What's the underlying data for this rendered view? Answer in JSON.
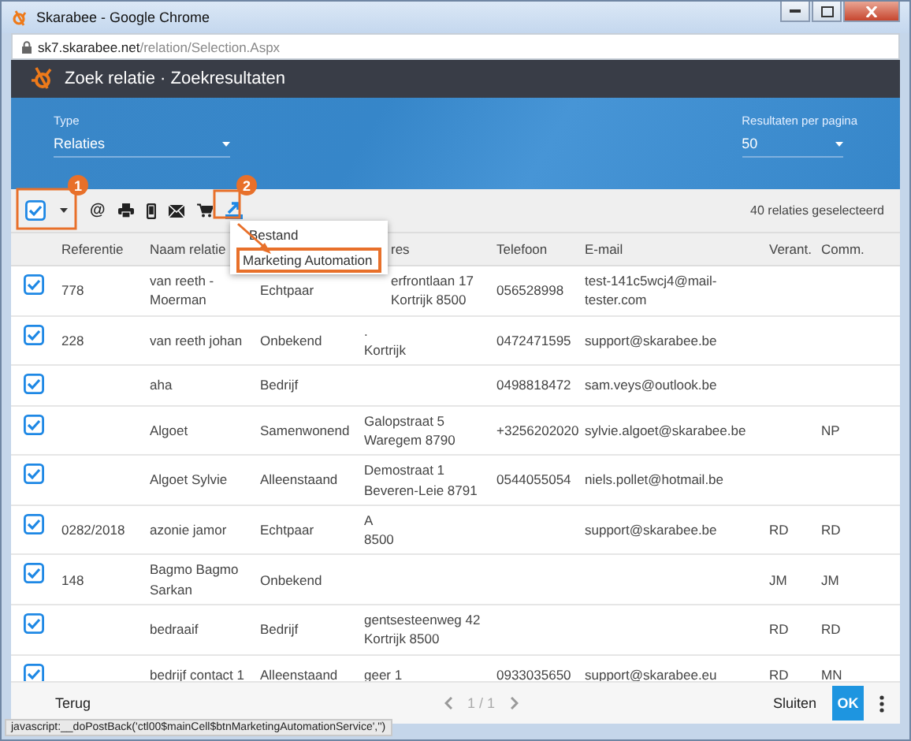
{
  "window": {
    "title": "Skarabee - Google Chrome",
    "url_host": "sk7.skarabee.net",
    "url_path": "/relation/Selection.Aspx"
  },
  "header": {
    "title": "Zoek relatie · Zoekresultaten"
  },
  "filters": [
    {
      "label": "Type",
      "value": "Relaties"
    },
    {
      "label": "Resultaten per pagina",
      "value": "50"
    }
  ],
  "toolbar": {
    "select_all": {
      "checked": true
    },
    "tools": [
      {
        "kind": "symbol",
        "symbol": "@"
      },
      {
        "kind": "printer"
      },
      {
        "kind": "phone"
      },
      {
        "kind": "envelope"
      },
      {
        "kind": "cart"
      },
      {
        "kind": "export"
      }
    ],
    "count": "40 relaties geselecteerd"
  },
  "export_menu": {
    "items": [
      {
        "label": "Bestand",
        "selected": false
      },
      {
        "label": "Marketing Automation",
        "selected": true
      }
    ]
  },
  "annotations": [
    {
      "label": "1"
    },
    {
      "label": "2"
    }
  ],
  "table": {
    "columns": [
      "Referentie",
      "Naam relatie",
      "res",
      "Telefoon",
      "E-mail",
      "Verant.",
      "Comm."
    ],
    "rows": [
      {
        "checked": true,
        "ref": "778",
        "name": "van reeth - Moerman",
        "type": "Echtpaar",
        "address": [
          "erfrontlaan 17",
          "Kortrijk 8500"
        ],
        "phone": "056528998",
        "email": "test-141c5wcj4@mail-tester.com"
      },
      {
        "checked": true,
        "ref": "228",
        "name": "van reeth johan",
        "type": "Onbekend",
        "address": [
          ".",
          "Kortrijk"
        ],
        "phone": "0472471595",
        "email": "support@skarabee.be"
      },
      {
        "checked": true,
        "name": "aha",
        "type": "Bedrijf",
        "phone": "0498818472",
        "email": "sam.veys@outlook.be"
      },
      {
        "checked": true,
        "name": "Algoet",
        "type": "Samenwonend",
        "address": [
          "Galopstraat 5",
          "Waregem 8790"
        ],
        "phone": "+3256202020",
        "email": "sylvie.algoet@skarabee.be",
        "comm": "NP"
      },
      {
        "checked": true,
        "name": "Algoet Sylvie",
        "type": "Alleenstaand",
        "address": [
          "Demostraat 1",
          "Beveren-Leie 8791"
        ],
        "phone": "0544055054",
        "email": "niels.pollet@hotmail.be"
      },
      {
        "checked": true,
        "ref": "0282/2018",
        "name": "azonie jamor",
        "type": "Echtpaar",
        "address": [
          "A",
          "8500"
        ],
        "email": "support@skarabee.be",
        "owner": "RD",
        "comm": "RD"
      },
      {
        "checked": true,
        "ref": "148",
        "name": "Bagmo Bagmo Sarkan",
        "type": "Onbekend",
        "owner": "JM",
        "comm": "JM"
      },
      {
        "checked": true,
        "name": "bedraaif",
        "type": "Bedrijf",
        "address": [
          "gentsesteenweg 42",
          "Kortrijk 8500"
        ],
        "owner": "RD",
        "comm": "RD"
      },
      {
        "checked": true,
        "name": "bedrijf contact 1",
        "type": "Alleenstaand",
        "address": [
          "geer 1"
        ],
        "phone": "0933035650",
        "email": "support@skarabee.eu",
        "owner": "RD",
        "comm": "MN"
      }
    ]
  },
  "footer": {
    "back": "Terug",
    "pager": "1 / 1",
    "close": "Sluiten",
    "ok": "OK"
  },
  "status_bar": "javascript:__doPostBack('ctl00$mainCell$btnMarketingAutomationService','')"
}
